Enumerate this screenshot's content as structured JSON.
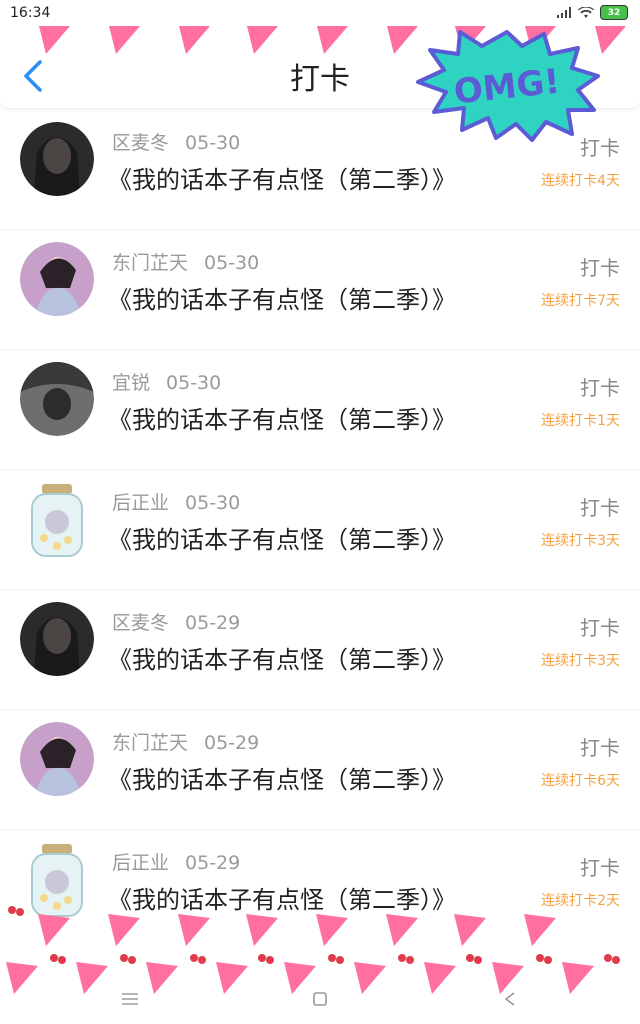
{
  "status": {
    "time": "16:34",
    "battery": "32"
  },
  "header": {
    "title": "打卡",
    "sticker_text": "OMG!"
  },
  "actions": {
    "punch_label": "打卡"
  },
  "records": [
    {
      "name": "区麦冬",
      "date": "05-30",
      "book": "《我的话本子有点怪（第二季）》",
      "streak": "连续打卡4天",
      "avatar": "girl-dark"
    },
    {
      "name": "东门芷天",
      "date": "05-30",
      "book": "《我的话本子有点怪（第二季）》",
      "streak": "连续打卡7天",
      "avatar": "girl-pink"
    },
    {
      "name": "宜锐",
      "date": "05-30",
      "book": "《我的话本子有点怪（第二季）》",
      "streak": "连续打卡1天",
      "avatar": "grey-photo"
    },
    {
      "name": "后正业",
      "date": "05-30",
      "book": "《我的话本子有点怪（第二季）》",
      "streak": "连续打卡3天",
      "avatar": "jar"
    },
    {
      "name": "区麦冬",
      "date": "05-29",
      "book": "《我的话本子有点怪（第二季）》",
      "streak": "连续打卡3天",
      "avatar": "girl-dark"
    },
    {
      "name": "东门芷天",
      "date": "05-29",
      "book": "《我的话本子有点怪（第二季）》",
      "streak": "连续打卡6天",
      "avatar": "girl-pink"
    },
    {
      "name": "后正业",
      "date": "05-29",
      "book": "《我的话本子有点怪（第二季）》",
      "streak": "连续打卡2天",
      "avatar": "jar"
    }
  ],
  "icons": {
    "back": "chevron-left-icon",
    "menu": "menu-icon",
    "home": "home-square-icon",
    "nav_back": "back-triangle-icon"
  },
  "colors": {
    "accent": "#2a8df5",
    "streak": "#f2a145",
    "sticker_fill": "#2fd3c2",
    "sticker_text": "#5b5bd6"
  }
}
